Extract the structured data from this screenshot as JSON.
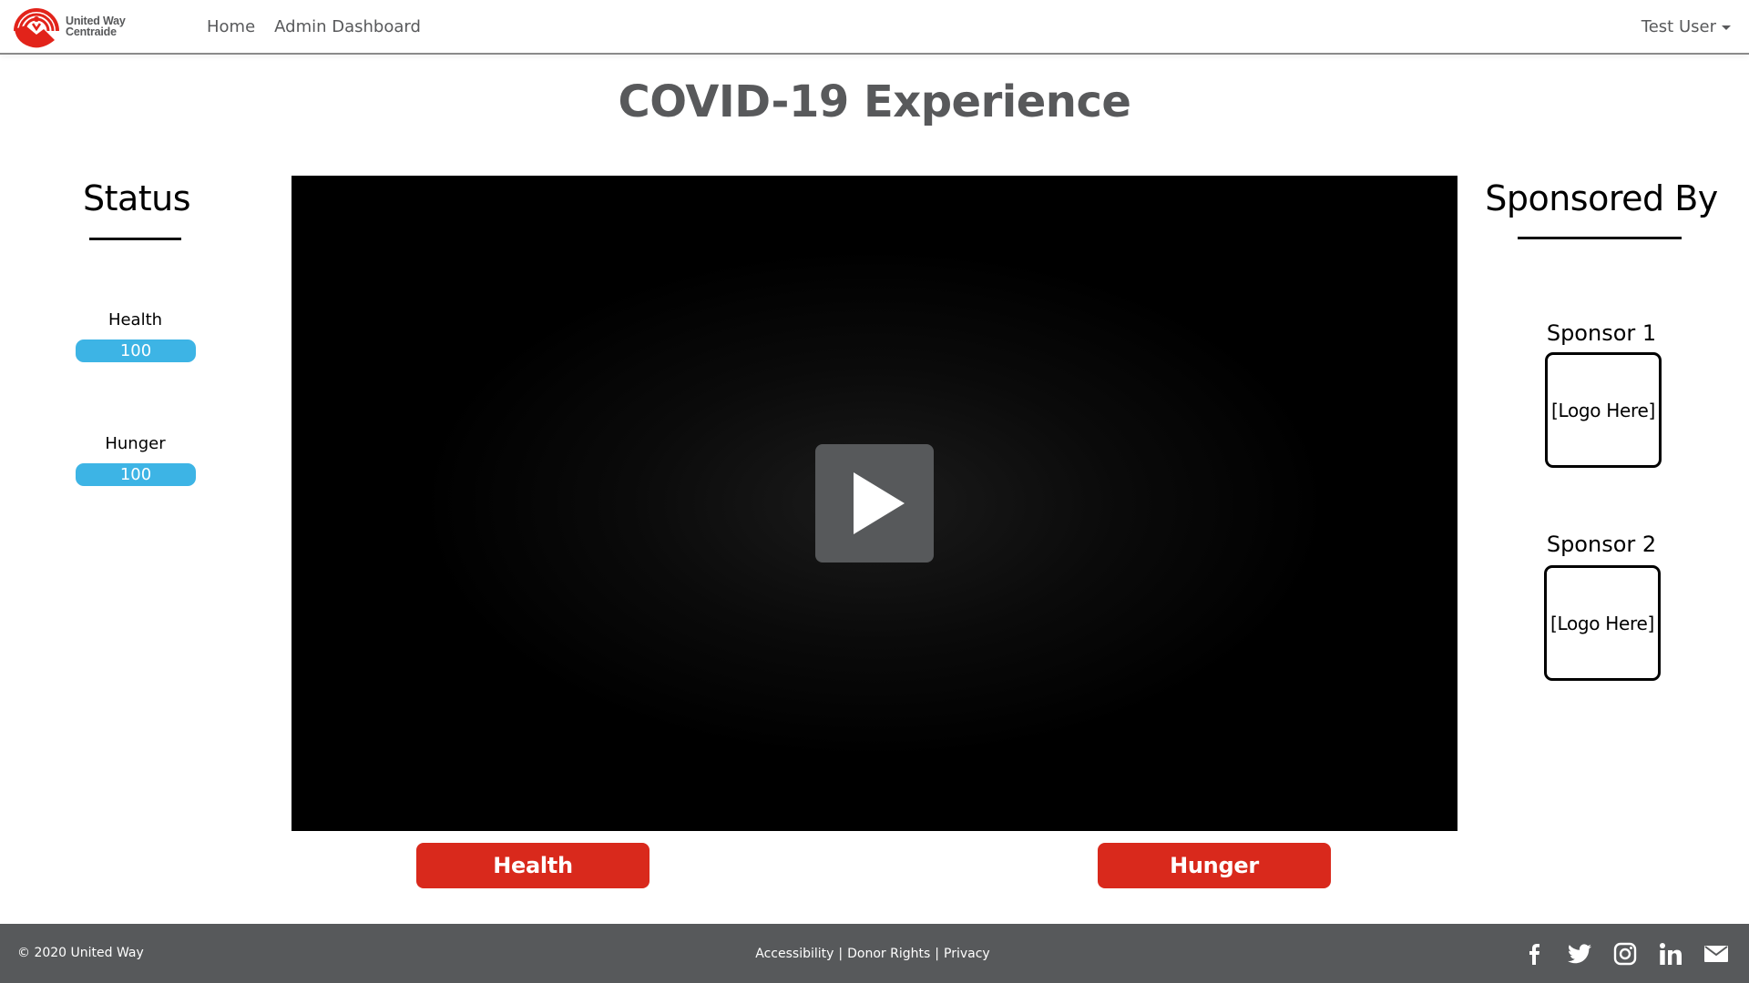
{
  "header": {
    "logo_line1": "United Way",
    "logo_line2": "Centraide",
    "nav": [
      {
        "label": "Home"
      },
      {
        "label": "Admin Dashboard"
      }
    ],
    "user_name": "Test User"
  },
  "page": {
    "title": "COVID-19 Experience"
  },
  "status": {
    "heading": "Status",
    "stats": [
      {
        "label": "Health",
        "value": "100"
      },
      {
        "label": "Hunger",
        "value": "100"
      }
    ]
  },
  "video": {
    "play_icon": "play-icon"
  },
  "actions": {
    "health_label": "Health",
    "hunger_label": "Hunger"
  },
  "sponsors": {
    "heading": "Sponsored By",
    "items": [
      {
        "label": "Sponsor 1",
        "logo_text": "[Logo Here]"
      },
      {
        "label": "Sponsor 2",
        "logo_text": "[Logo Here]"
      }
    ]
  },
  "footer": {
    "copyright": "© 2020 United Way",
    "links": [
      {
        "label": "Accessibility"
      },
      {
        "label": "Donor Rights"
      },
      {
        "label": "Privacy"
      }
    ],
    "separator": "|",
    "social": [
      "facebook-icon",
      "twitter-icon",
      "instagram-icon",
      "linkedin-icon",
      "email-icon"
    ]
  },
  "colors": {
    "brand_red": "#d9291c",
    "status_blue": "#3db4e5",
    "footer_gray": "#57595b",
    "text_gray": "#58595b"
  }
}
